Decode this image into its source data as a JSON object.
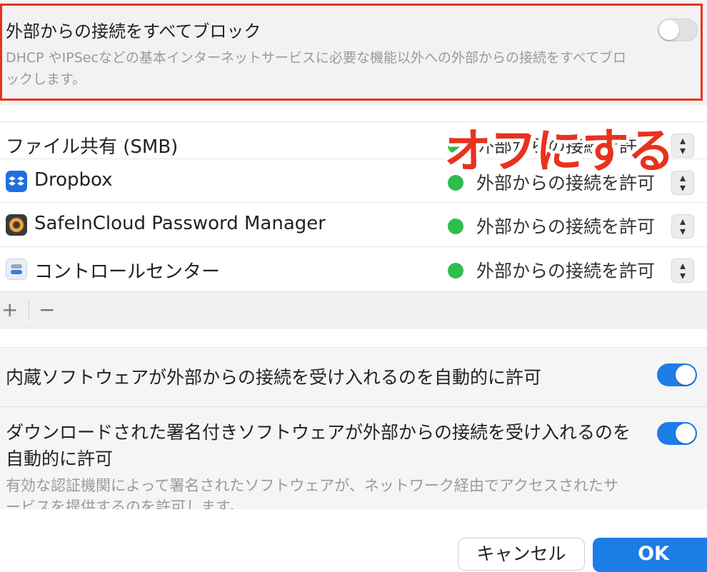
{
  "block_all": {
    "title": "外部からの接続をすべてブロック",
    "description": "DHCP やIPSecなどの基本インターネットサービスに必要な機能以外への外部からの接続をすべてブロックします。",
    "toggle_on": false
  },
  "annotation": "オフにする",
  "apps": [
    {
      "name": "ファイル共有 (SMB)",
      "icon": "none",
      "status": "外部からの接続を許可"
    },
    {
      "name": "Dropbox",
      "icon": "dropbox-icon",
      "status": "外部からの接続を許可"
    },
    {
      "name": "SafeInCloud Password Manager",
      "icon": "safeincloud-icon",
      "status": "外部からの接続を許可"
    },
    {
      "name": "コントロールセンター",
      "icon": "control-center-icon",
      "status": "外部からの接続を許可"
    }
  ],
  "toolbar": {
    "add": "+",
    "remove": "−"
  },
  "settings": {
    "builtin_label": "内蔵ソフトウェアが外部からの接続を受け入れるのを自動的に許可",
    "builtin_on": true,
    "signed_label": "ダウンロードされた署名付きソフトウェアが外部からの接続を受け入れるのを自動的に許可",
    "signed_on": true,
    "signed_desc": "有効な認証機関によって署名されたソフトウェアが、ネットワーク経由でアクセスされたサービスを提供するのを許可します。"
  },
  "buttons": {
    "cancel": "キャンセル",
    "ok": "OK"
  },
  "colors": {
    "accent": "#1c7de6",
    "highlight": "#e8321e",
    "status_green": "#2ebd4f"
  }
}
